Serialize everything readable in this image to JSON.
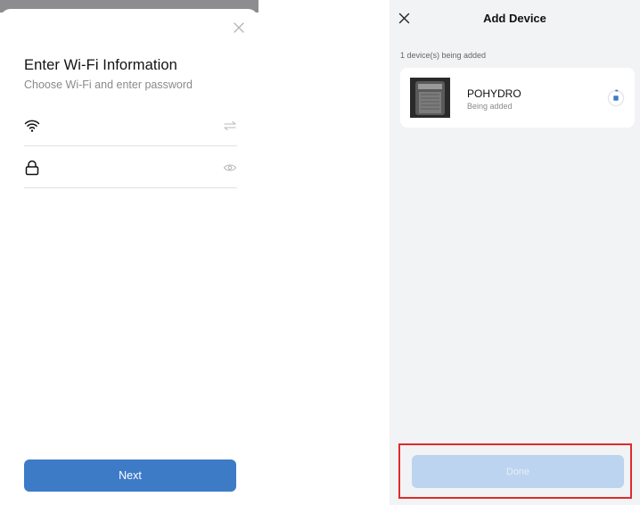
{
  "wifi_screen": {
    "title": "Enter Wi-Fi Information",
    "subtitle": "Choose Wi-Fi and enter password",
    "ssid_field": {
      "value": "",
      "placeholder": "",
      "icon": "wifi-icon",
      "action_icon": "switch-arrows-icon"
    },
    "password_field": {
      "value": "",
      "placeholder": "",
      "icon": "lock-icon",
      "action_icon": "eye-icon"
    },
    "next_label": "Next",
    "accent_color": "#3d7bc7"
  },
  "add_device_screen": {
    "title": "Add Device",
    "adding_count": "1 device(s) being added",
    "device": {
      "name": "POHYDRO",
      "status": "Being added",
      "thumbnail_icon": "device-thumbnail"
    },
    "done_label": "Done",
    "done_color": "#bcd4ef",
    "highlight_color": "#e02b2b"
  }
}
